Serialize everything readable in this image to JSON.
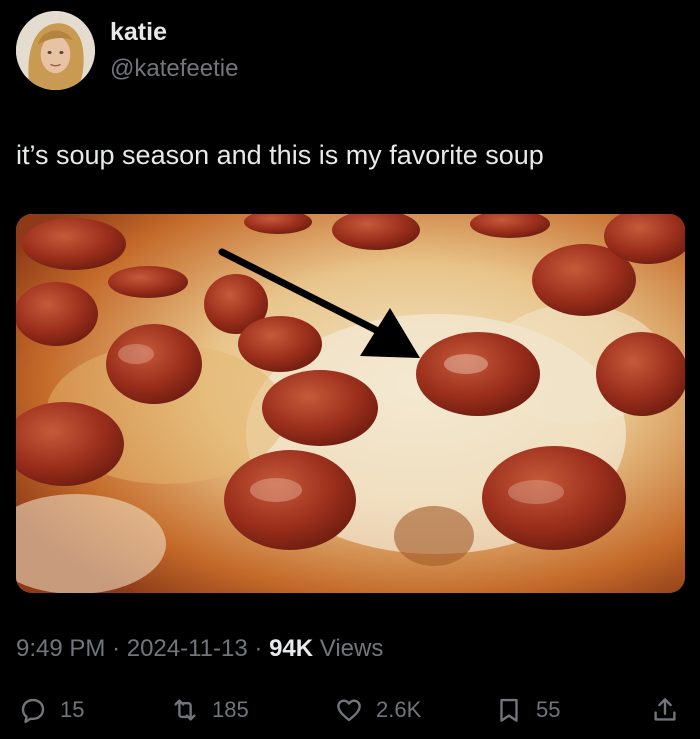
{
  "author": {
    "name": "katie",
    "handle": "@katefeetie"
  },
  "tweet": {
    "text": "it’s soup season and this is my favorite soup"
  },
  "meta": {
    "time": "9:49 PM",
    "separator": "·",
    "date": "2024-11-13",
    "views_count": "94K",
    "views_label": "Views"
  },
  "actions": {
    "replies": "15",
    "reposts": "185",
    "likes": "2.6K",
    "bookmarks": "55"
  },
  "icons": {
    "reply": "reply-icon",
    "repost": "repost-icon",
    "like": "heart-icon",
    "bookmark": "bookmark-icon",
    "share": "share-icon"
  },
  "colors": {
    "background": "#000000",
    "text_primary": "#e7e9ea",
    "text_secondary": "#71767b"
  }
}
